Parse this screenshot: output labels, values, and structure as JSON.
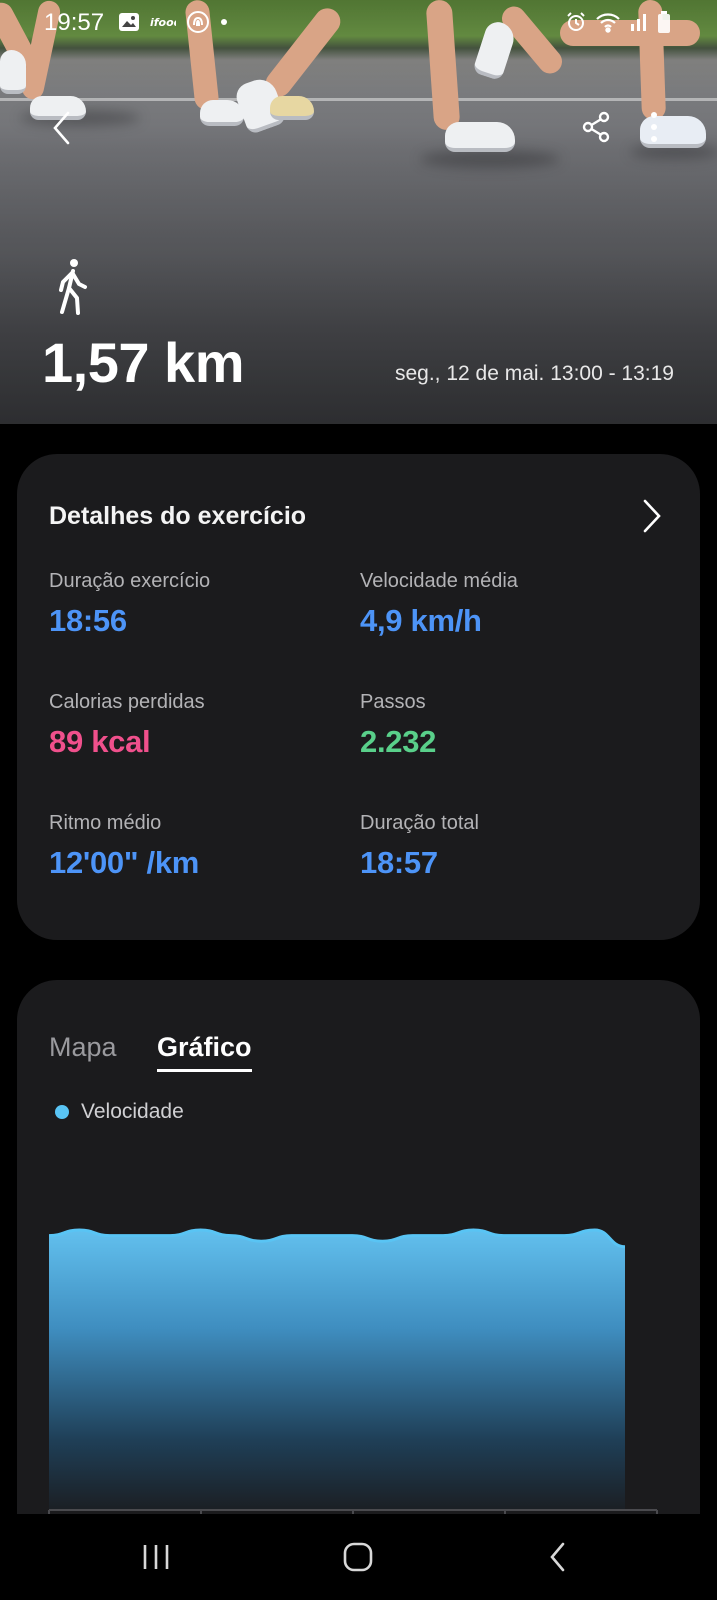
{
  "status_bar": {
    "time": "19:57",
    "left_icons": [
      "gallery-icon",
      "app-icon",
      "fingerprint-icon",
      "dot-icon"
    ],
    "right_icons": [
      "alarm-icon",
      "wifi-icon",
      "signal-icon",
      "battery-icon"
    ]
  },
  "hero": {
    "distance": "1,57 km",
    "datetime": "seg., 12 de mai. 13:00 - 13:19",
    "activity_icon": "walking-icon"
  },
  "details": {
    "title": "Detalhes do exercício",
    "stats": [
      {
        "label": "Duração exercício",
        "value": "18:56",
        "color": "#4d94f7"
      },
      {
        "label": "Velocidade média",
        "value": "4,9 km/h",
        "color": "#4d94f7"
      },
      {
        "label": "Calorias perdidas",
        "value": "89 kcal",
        "color": "#f0508c"
      },
      {
        "label": "Passos",
        "value": "2.232",
        "color": "#59d08a"
      },
      {
        "label": "Ritmo médio",
        "value": "12'00\" /km",
        "color": "#4d94f7"
      },
      {
        "label": "Duração total",
        "value": "18:57",
        "color": "#4d94f7"
      }
    ]
  },
  "chart_section": {
    "tabs": [
      {
        "label": "Mapa",
        "selected": false
      },
      {
        "label": "Gráfico",
        "selected": true
      }
    ],
    "legend": "Velocidade",
    "legend_color": "#59c4f4"
  },
  "chart_data": {
    "type": "area",
    "series": [
      {
        "name": "Velocidade",
        "values": [
          4.9,
          5.0,
          4.9,
          4.9,
          4.9,
          5.0,
          4.9,
          4.8,
          4.9,
          4.9,
          4.9,
          4.8,
          4.9,
          4.9,
          5.0,
          4.9,
          4.9,
          4.9,
          5.0,
          4.7
        ]
      }
    ]
  },
  "navbar": {
    "buttons": [
      "recent-apps-icon",
      "home-icon",
      "back-icon"
    ]
  }
}
